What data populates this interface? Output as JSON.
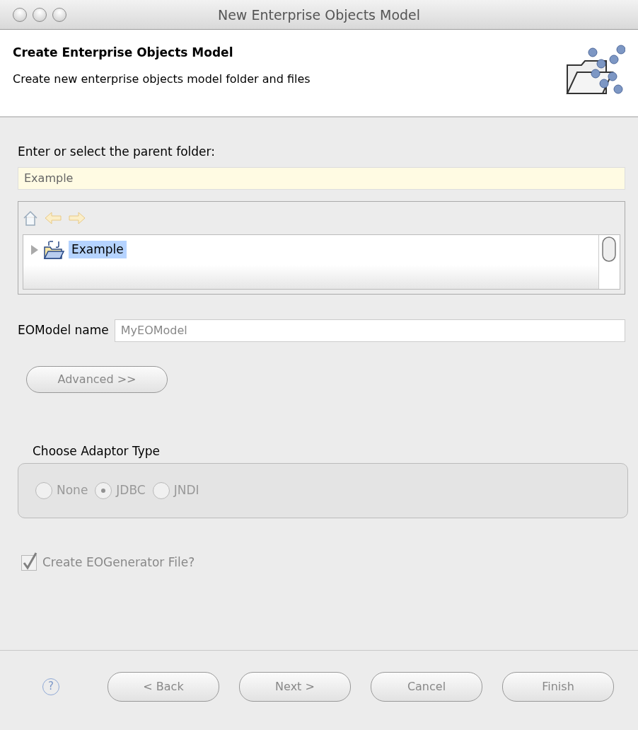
{
  "window": {
    "title": "New Enterprise Objects Model"
  },
  "header": {
    "title": "Create Enterprise Objects Model",
    "description": "Create new enterprise objects model folder and files"
  },
  "folder": {
    "label": "Enter or select the parent folder:",
    "value": "Example"
  },
  "tree": {
    "items": [
      {
        "label": "Example",
        "selected": true,
        "expanded": false
      }
    ]
  },
  "model_name": {
    "label": "EOModel name",
    "value": "MyEOModel",
    "disabled": true
  },
  "advanced_button": {
    "label": "Advanced >>",
    "disabled": true
  },
  "adaptor": {
    "title": "Choose Adaptor Type",
    "options": [
      {
        "label": "None",
        "selected": false,
        "disabled": true
      },
      {
        "label": "JDBC",
        "selected": true,
        "disabled": true
      },
      {
        "label": "JNDI",
        "selected": false,
        "disabled": true
      }
    ]
  },
  "generator": {
    "label": "Create EOGenerator File?",
    "checked": true,
    "disabled": true
  },
  "help": {
    "label": "?"
  },
  "buttons": [
    {
      "label": "< Back",
      "disabled": true
    },
    {
      "label": "Next >",
      "disabled": true
    },
    {
      "label": "Cancel",
      "disabled": true
    },
    {
      "label": "Finish",
      "disabled": true
    }
  ]
}
